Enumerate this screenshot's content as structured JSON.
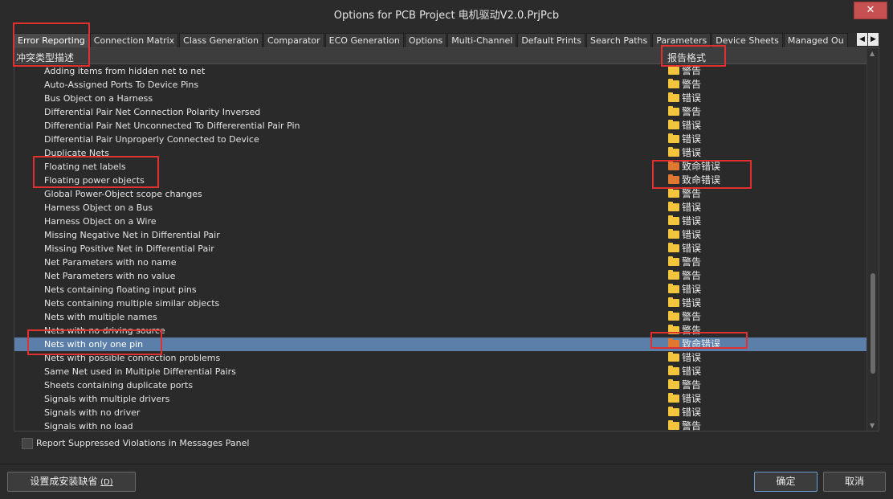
{
  "window": {
    "title": "Options for PCB Project 电机驱动V2.0.PrjPcb",
    "close_label": "✕"
  },
  "tabs": [
    {
      "label": "Error Reporting",
      "active": true
    },
    {
      "label": "Connection Matrix"
    },
    {
      "label": "Class Generation"
    },
    {
      "label": "Comparator"
    },
    {
      "label": "ECO Generation"
    },
    {
      "label": "Options"
    },
    {
      "label": "Multi-Channel"
    },
    {
      "label": "Default Prints"
    },
    {
      "label": "Search Paths"
    },
    {
      "label": "Parameters"
    },
    {
      "label": "Device Sheets"
    },
    {
      "label": "Managed Ou"
    }
  ],
  "tab_scroll": {
    "left": "◀",
    "right": "▶"
  },
  "table": {
    "col_violation": "冲突类型描述",
    "col_report": "报告格式",
    "rows": [
      {
        "name": "Adding items from hidden net to net",
        "level": "警告",
        "color": "yellow"
      },
      {
        "name": "Auto-Assigned Ports To Device Pins",
        "level": "警告",
        "color": "yellow"
      },
      {
        "name": "Bus Object on a Harness",
        "level": "错误",
        "color": "yellow"
      },
      {
        "name": "Differential Pair Net Connection Polarity Inversed",
        "level": "警告",
        "color": "yellow"
      },
      {
        "name": "Differential Pair Net Unconnected To Differerential Pair Pin",
        "level": "错误",
        "color": "yellow"
      },
      {
        "name": "Differential Pair Unproperly Connected to Device",
        "level": "错误",
        "color": "yellow"
      },
      {
        "name": "Duplicate Nets",
        "level": "错误",
        "color": "yellow"
      },
      {
        "name": "Floating net labels",
        "level": "致命错误",
        "color": "orange"
      },
      {
        "name": "Floating power objects",
        "level": "致命错误",
        "color": "orange"
      },
      {
        "name": "Global Power-Object scope changes",
        "level": "警告",
        "color": "yellow"
      },
      {
        "name": "Harness Object on a Bus",
        "level": "错误",
        "color": "yellow"
      },
      {
        "name": "Harness Object on a Wire",
        "level": "错误",
        "color": "yellow"
      },
      {
        "name": "Missing Negative Net in Differential Pair",
        "level": "错误",
        "color": "yellow"
      },
      {
        "name": "Missing Positive Net in Differential Pair",
        "level": "错误",
        "color": "yellow"
      },
      {
        "name": "Net Parameters with no name",
        "level": "警告",
        "color": "yellow"
      },
      {
        "name": "Net Parameters with no value",
        "level": "警告",
        "color": "yellow"
      },
      {
        "name": "Nets containing floating input pins",
        "level": "错误",
        "color": "yellow"
      },
      {
        "name": "Nets containing multiple similar objects",
        "level": "错误",
        "color": "yellow"
      },
      {
        "name": "Nets with multiple names",
        "level": "警告",
        "color": "yellow"
      },
      {
        "name": "Nets with no driving source",
        "level": "警告",
        "color": "yellow"
      },
      {
        "name": "Nets with only one pin",
        "level": "致命错误",
        "color": "orange",
        "selected": true
      },
      {
        "name": "Nets with possible connection problems",
        "level": "错误",
        "color": "yellow"
      },
      {
        "name": "Same Net used in Multiple Differential Pairs",
        "level": "错误",
        "color": "yellow"
      },
      {
        "name": "Sheets containing duplicate ports",
        "level": "警告",
        "color": "yellow"
      },
      {
        "name": "Signals with multiple drivers",
        "level": "错误",
        "color": "yellow"
      },
      {
        "name": "Signals with no driver",
        "level": "错误",
        "color": "yellow"
      },
      {
        "name": "Signals with no load",
        "level": "警告",
        "color": "yellow"
      }
    ]
  },
  "checkbox": {
    "label": "Report Suppressed Violations in Messages Panel",
    "checked": false
  },
  "buttons": {
    "set_default": "设置成安装缺省 ",
    "set_default_key": "(D)",
    "ok": "确定",
    "cancel": "取消"
  },
  "colors": {
    "folder_warning": "#f2c53d",
    "folder_fatal": "#e0782f",
    "selection": "#5b7fa8",
    "annotation": "#e03030"
  }
}
